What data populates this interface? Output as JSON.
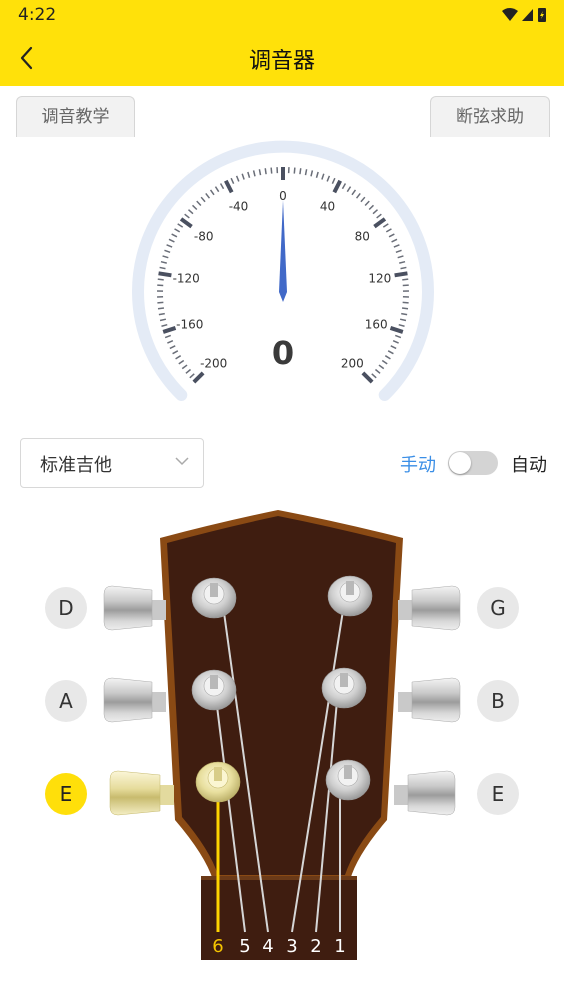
{
  "status": {
    "time": "4:22"
  },
  "appbar": {
    "title": "调音器"
  },
  "tabs": {
    "left": "调音教学",
    "right": "断弦求助"
  },
  "gauge": {
    "value": "0",
    "scale_labels": [
      {
        "label": "-200",
        "value": -200
      },
      {
        "label": "-160",
        "value": -160
      },
      {
        "label": "-120",
        "value": -120
      },
      {
        "label": "-80",
        "value": -80
      },
      {
        "label": "-40",
        "value": -40
      },
      {
        "label": "0",
        "value": 0
      },
      {
        "label": "40",
        "value": 40
      },
      {
        "label": "80",
        "value": 80
      },
      {
        "label": "120",
        "value": 120
      },
      {
        "label": "160",
        "value": 160
      },
      {
        "label": "200",
        "value": 200
      }
    ],
    "needle_value": 0
  },
  "tuning_select": {
    "value": "标准吉他"
  },
  "mode": {
    "manual": "手动",
    "auto": "自动",
    "toggle_on": false
  },
  "notes": {
    "left": [
      "D",
      "A",
      "E"
    ],
    "right": [
      "G",
      "B",
      "E"
    ],
    "active": "E"
  },
  "string_numbers": [
    "6",
    "5",
    "4",
    "3",
    "2",
    "1"
  ],
  "active_string": "6",
  "colors": {
    "accent": "#ffe10a",
    "manual_blue": "#3a8ee6",
    "headstock": "#3f1d10",
    "binding": "#8a4a14"
  }
}
